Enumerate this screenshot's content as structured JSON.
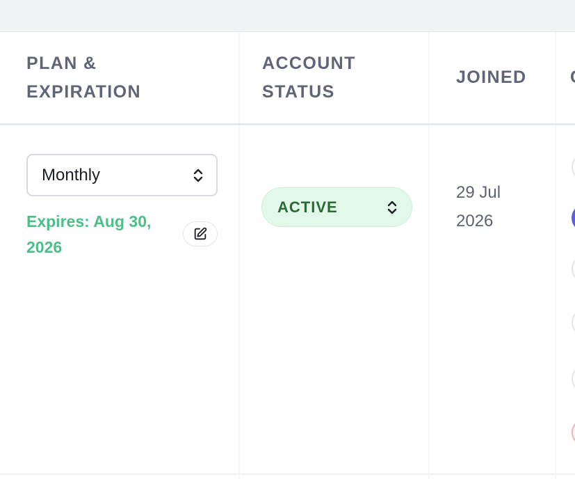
{
  "columns": {
    "plan_line1": "PLAN &",
    "plan_line2": "EXPIRATION",
    "status_line1": "ACCOUNT",
    "status_line2": "STATUS",
    "joined": "JOINED",
    "next": "C"
  },
  "row": {
    "plan": {
      "selected": "Monthly",
      "expires_line1": "Expires: Aug 30,",
      "expires_line2": "2026"
    },
    "status": {
      "selected": "ACTIVE"
    },
    "joined_line1": "29 Jul",
    "joined_line2": "2026"
  },
  "icons": {
    "select_chevron": "chevron-up-down-icon",
    "edit": "edit-icon"
  },
  "colors": {
    "expires": "#4bbf87",
    "status_bg": "#e2f8e8",
    "status_text": "#2a6b35",
    "header_text": "#5f6577",
    "primary_action": "#5b5fe0",
    "danger_action": "#f3b2b2"
  }
}
